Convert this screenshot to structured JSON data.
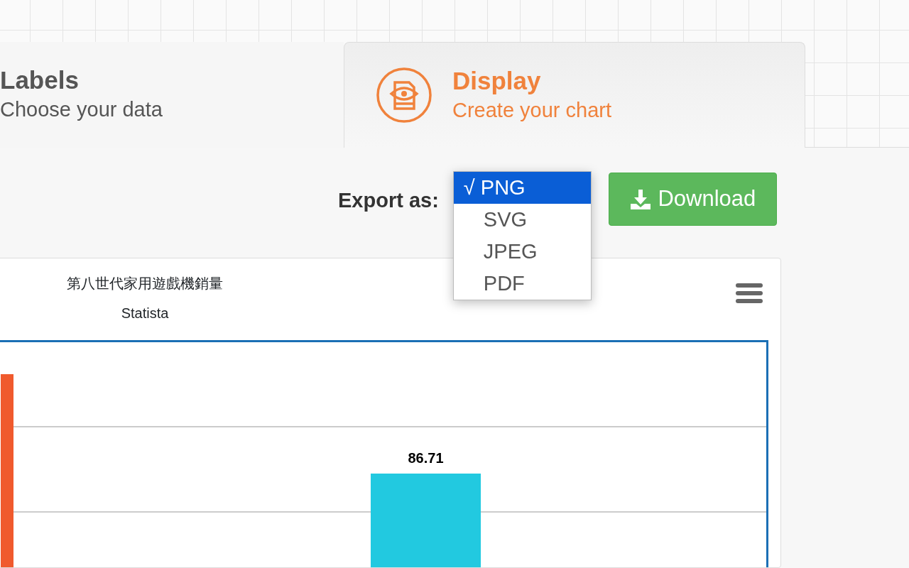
{
  "tabs": [
    {
      "title": "Labels",
      "subtitle": "Choose your data",
      "selected": false
    },
    {
      "title": "Display",
      "subtitle": "Create your chart",
      "selected": true
    }
  ],
  "export": {
    "label": "Export as:",
    "check_mark": "√",
    "options": [
      {
        "label": "PNG",
        "selected": true
      },
      {
        "label": "SVG",
        "selected": false
      },
      {
        "label": "JPEG",
        "selected": false
      },
      {
        "label": "PDF",
        "selected": false
      }
    ],
    "button": "Download"
  },
  "chart": {
    "title": "第八世代家用遊戲機銷量",
    "subtitle": "Statista",
    "bars": [
      {
        "color": "#f05a2d"
      },
      {
        "color": "#22c9e0",
        "value_label": "86.71"
      }
    ]
  }
}
